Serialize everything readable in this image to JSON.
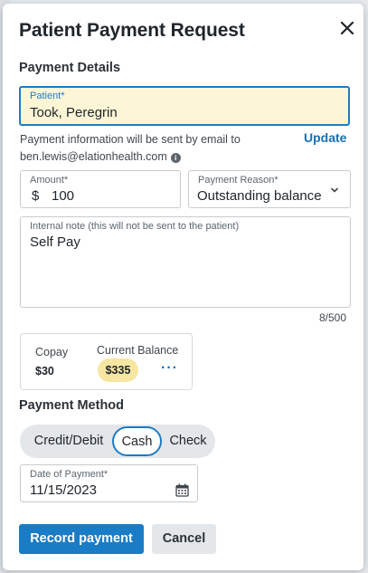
{
  "modal": {
    "title": "Patient Payment Request",
    "sections": {
      "details": "Payment Details",
      "method": "Payment Method"
    }
  },
  "patient": {
    "label": "Patient*",
    "value": "Took, Peregrin"
  },
  "email_info": {
    "line1": "Payment information will be sent by email to",
    "email": "ben.lewis@elationhealth.com",
    "update_label": "Update"
  },
  "amount": {
    "label": "Amount*",
    "currency": "$",
    "value": "100"
  },
  "reason": {
    "label": "Payment Reason*",
    "value": "Outstanding balance"
  },
  "note": {
    "label": "Internal note (this will not be sent to the patient)",
    "value": "Self Pay",
    "counter": "8/500"
  },
  "balances": {
    "copay_label": "Copay",
    "copay_value": "$30",
    "current_label": "Current Balance",
    "current_value": "$335",
    "more": "···"
  },
  "method": {
    "options": [
      "Credit/Debit",
      "Cash",
      "Check"
    ],
    "selected": "Cash"
  },
  "date": {
    "label": "Date of Payment*",
    "value": "11/15/2023"
  },
  "actions": {
    "record": "Record payment",
    "cancel": "Cancel"
  },
  "colors": {
    "primary": "#1b7cc6",
    "highlight": "#fdf6d6",
    "balance_pill": "#f7e6a1"
  }
}
